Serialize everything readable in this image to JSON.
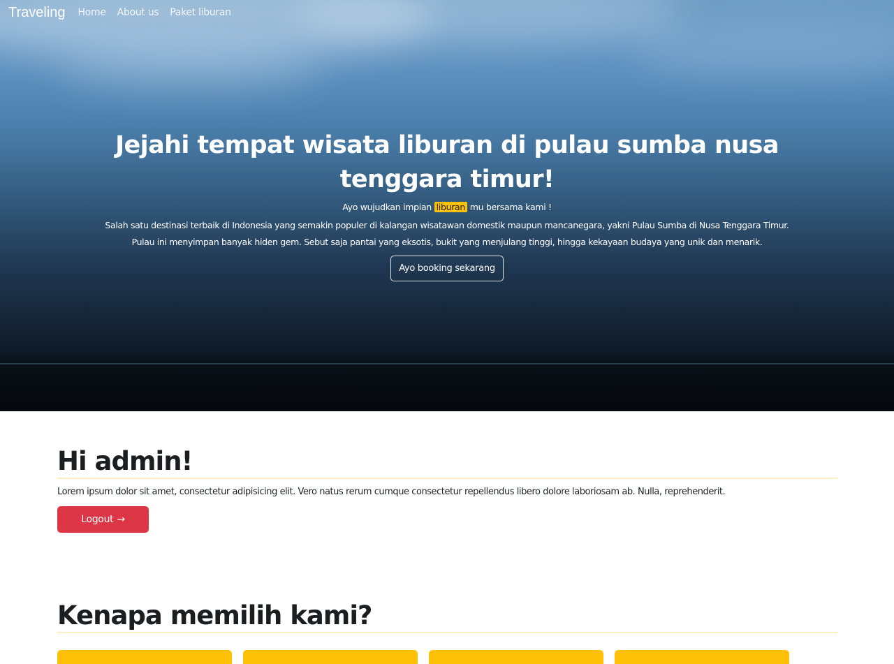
{
  "navbar": {
    "brand": "Traveling",
    "links": [
      {
        "label": "Home"
      },
      {
        "label": "About us"
      },
      {
        "label": "Paket liburan"
      }
    ]
  },
  "hero": {
    "title": "Jejahi tempat wisata liburan di pulau sumba nusa tenggara timur!",
    "tagline_before": "Ayo wujudkan impian ",
    "tagline_highlight": "liburan",
    "tagline_after": " mu bersama kami !",
    "description": "Salah satu destinasi terbaik di Indonesia yang semakin populer di kalangan wisatawan domestik maupun mancanegara, yakni Pulau Sumba di Nusa Tenggara Timur. Pulau ini menyimpan banyak hiden gem. Sebut saja pantai yang eksotis, bukit yang menjulang tinggi, hingga kekayaan budaya yang unik dan menarik.",
    "cta_label": "Ayo booking sekarang"
  },
  "greeting": {
    "title": "Hi admin!",
    "text": "Lorem ipsum dolor sit amet, consectetur adipisicing elit. Vero natus rerum cumque consectetur repellendus libero dolore laboriosam ab. Nulla, reprehenderit.",
    "logout_label": "Logout",
    "logout_icon": "arrow-right-icon",
    "logout_arrow": "→"
  },
  "why": {
    "title": "Kenapa memilih kami?"
  },
  "colors": {
    "accent": "#ffc107",
    "danger": "#dc3545",
    "heading": "#1b1e21"
  }
}
